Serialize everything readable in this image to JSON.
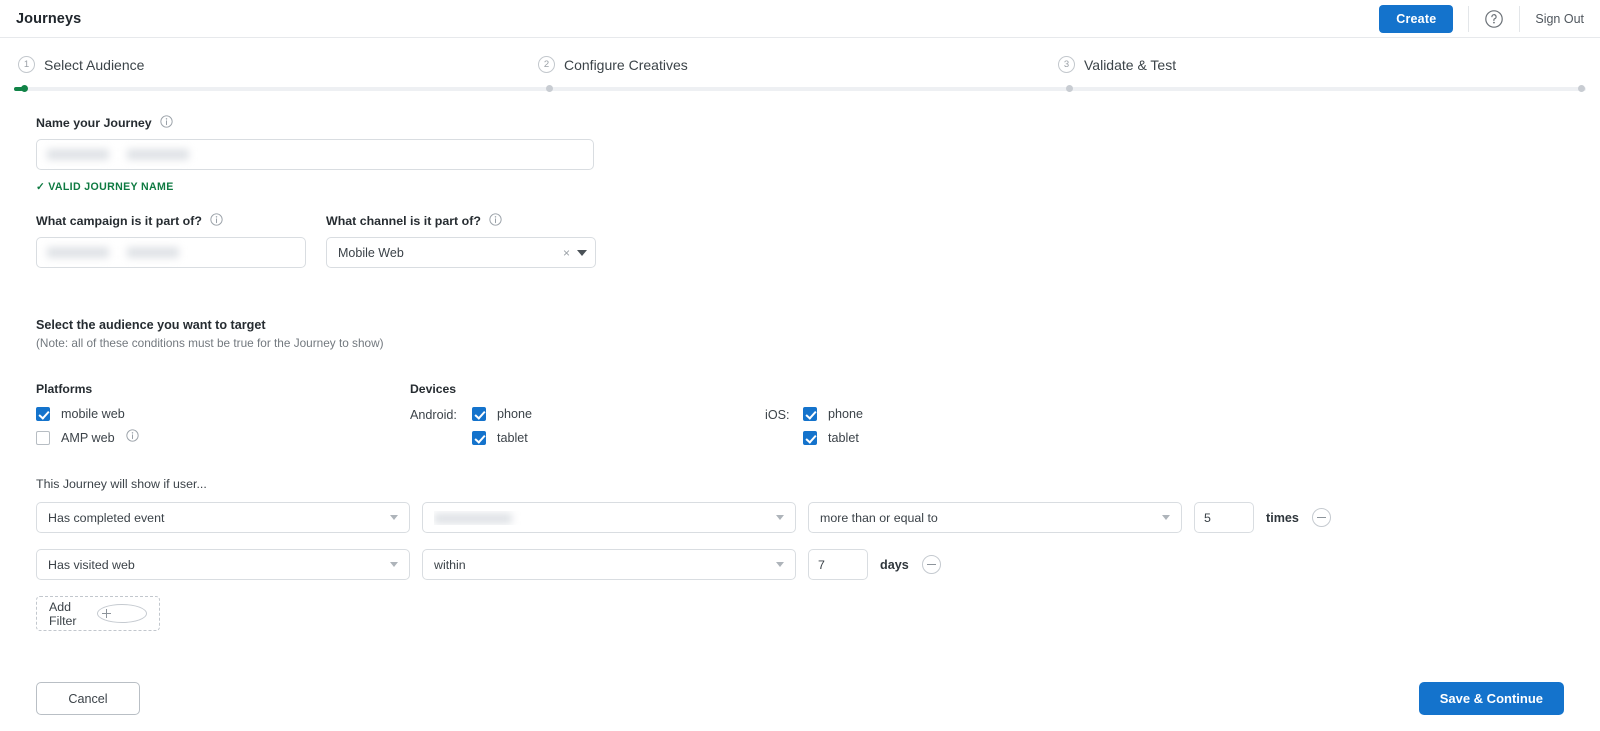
{
  "header": {
    "app_title": "Journeys",
    "create_label": "Create",
    "help_icon": "question-circle-icon",
    "sign_out_label": "Sign Out",
    "accent_color": "#1473cc"
  },
  "stepper": {
    "active_index": 0,
    "progress_color": "#118347",
    "steps": [
      {
        "num": "1",
        "label": "Select Audience"
      },
      {
        "num": "2",
        "label": "Configure Creatives"
      },
      {
        "num": "3",
        "label": "Validate & Test"
      }
    ]
  },
  "form": {
    "journey_name": {
      "label": "Name your Journey",
      "info_icon": "info-icon",
      "value": "",
      "redacted": true,
      "validation_text": "VALID JOURNEY NAME",
      "validation_check": "✓",
      "validation_color": "#0e7a41"
    },
    "campaign": {
      "label": "What campaign is it part of?",
      "info_icon": "info-icon",
      "value": "",
      "redacted": true
    },
    "channel": {
      "label": "What channel is it part of?",
      "info_icon": "info-icon",
      "value": "Mobile Web",
      "clear_glyph": "×"
    }
  },
  "audience": {
    "title": "Select the audience you want to target",
    "note": "(Note: all of these conditions must be true for the Journey to show)",
    "platforms": {
      "heading": "Platforms",
      "items": [
        {
          "label": "mobile web",
          "checked": true,
          "info": false
        },
        {
          "label": "AMP web",
          "checked": false,
          "info": true
        }
      ]
    },
    "devices": {
      "heading": "Devices",
      "android": {
        "prefix": "Android:",
        "items": [
          {
            "label": "phone",
            "checked": true
          },
          {
            "label": "tablet",
            "checked": true
          }
        ]
      },
      "ios": {
        "prefix": "iOS:",
        "items": [
          {
            "label": "phone",
            "checked": true
          },
          {
            "label": "tablet",
            "checked": true
          }
        ]
      }
    }
  },
  "filters": {
    "title": "This Journey will show if user...",
    "rows": [
      {
        "condition": "Has completed event",
        "attribute": "",
        "attribute_redacted": true,
        "operator": "more than or equal to",
        "number": "5",
        "unit": "times",
        "remove_icon": "minus-circle-icon"
      },
      {
        "condition": "Has visited web",
        "operator": "within",
        "number": "7",
        "unit": "days",
        "remove_icon": "minus-circle-icon"
      }
    ],
    "add_filter_label": "Add Filter",
    "add_filter_icon": "plus-circle-icon"
  },
  "footer": {
    "cancel_label": "Cancel",
    "save_label": "Save & Continue"
  }
}
